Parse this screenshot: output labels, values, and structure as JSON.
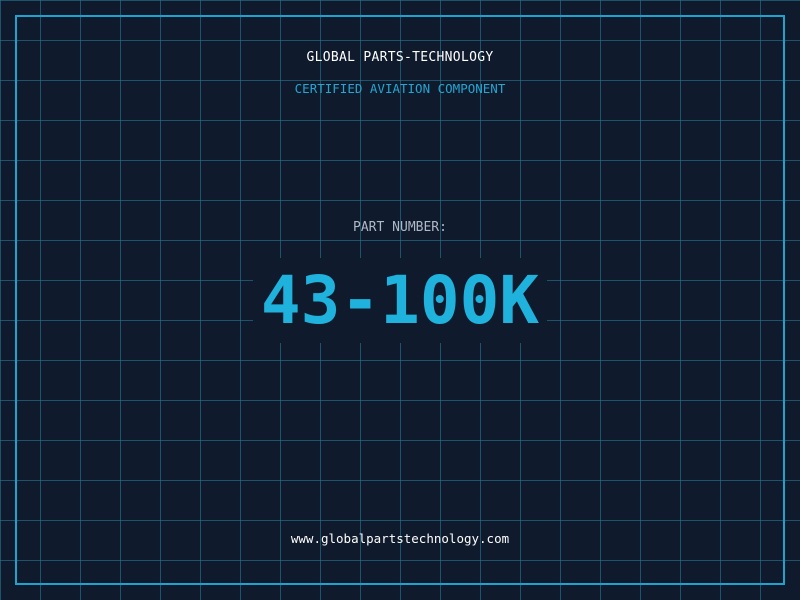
{
  "brand": {
    "title": "GLOBAL PARTS-TECHNOLOGY",
    "subtitle": "CERTIFIED AVIATION COMPONENT"
  },
  "part": {
    "label": "PART NUMBER:",
    "number": "43-100K"
  },
  "footer": {
    "website": "www.globalpartstechnology.com"
  },
  "colors": {
    "background": "#0f1a2d",
    "grid": "#28829f",
    "accent": "#1ea3cf",
    "title_text": "#ffffff",
    "label_text": "#aeb8c6"
  }
}
